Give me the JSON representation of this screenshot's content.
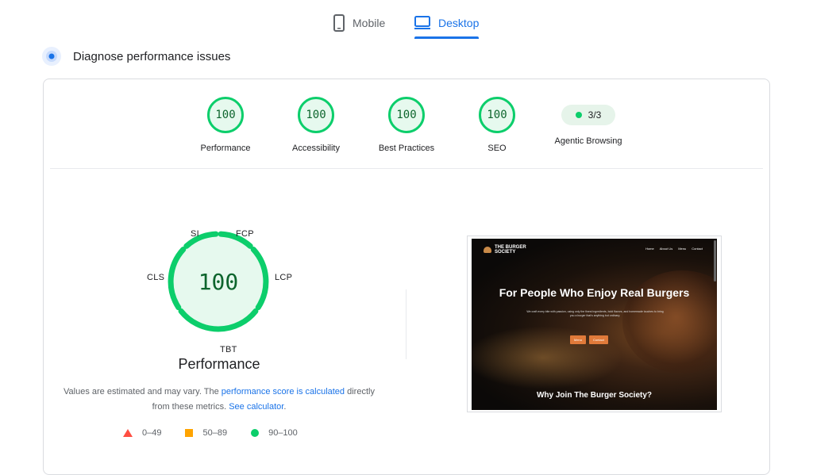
{
  "tabs": {
    "mobile": "Mobile",
    "desktop": "Desktop"
  },
  "diagnose": {
    "title": "Diagnose performance issues"
  },
  "categories": [
    {
      "score": "100",
      "label": "Performance"
    },
    {
      "score": "100",
      "label": "Accessibility"
    },
    {
      "score": "100",
      "label": "Best Practices"
    },
    {
      "score": "100",
      "label": "SEO"
    }
  ],
  "agentic": {
    "value": "3/3",
    "label": "Agentic Browsing"
  },
  "main_gauge": {
    "score": "100",
    "title": "Performance",
    "metrics": {
      "si": "SI",
      "fcp": "FCP",
      "lcp": "LCP",
      "cls": "CLS",
      "tbt": "TBT"
    }
  },
  "note": {
    "prefix": "Values are estimated and may vary. The ",
    "link1": "performance score is calculated",
    "middle": " directly from these metrics. ",
    "link2": "See calculator",
    "suffix": "."
  },
  "legend": [
    {
      "label": "0–49",
      "color": "#ff4e42"
    },
    {
      "label": "50–89",
      "color": "#ffa400"
    },
    {
      "label": "90–100",
      "color": "#0cce6b"
    }
  ],
  "screenshot": {
    "logo_line1": "THE BURGER",
    "logo_line2": "SOCIETY",
    "nav": [
      "Home",
      "About Us",
      "Menu",
      "Contact"
    ],
    "hero_title": "For People Who Enjoy Real Burgers",
    "hero_sub": "We craft every bite with passion, using only the finest ingredients, bold flavors, and homemade touches to bring you a burger that's anything but ordinary.",
    "btn_menu": "Menu",
    "btn_contact": "Contact",
    "why": "Why Join The Burger Society?"
  },
  "colors": {
    "accent": "#1a73e8",
    "pass": "#0cce6b",
    "average": "#ffa400",
    "fail": "#ff4e42"
  }
}
